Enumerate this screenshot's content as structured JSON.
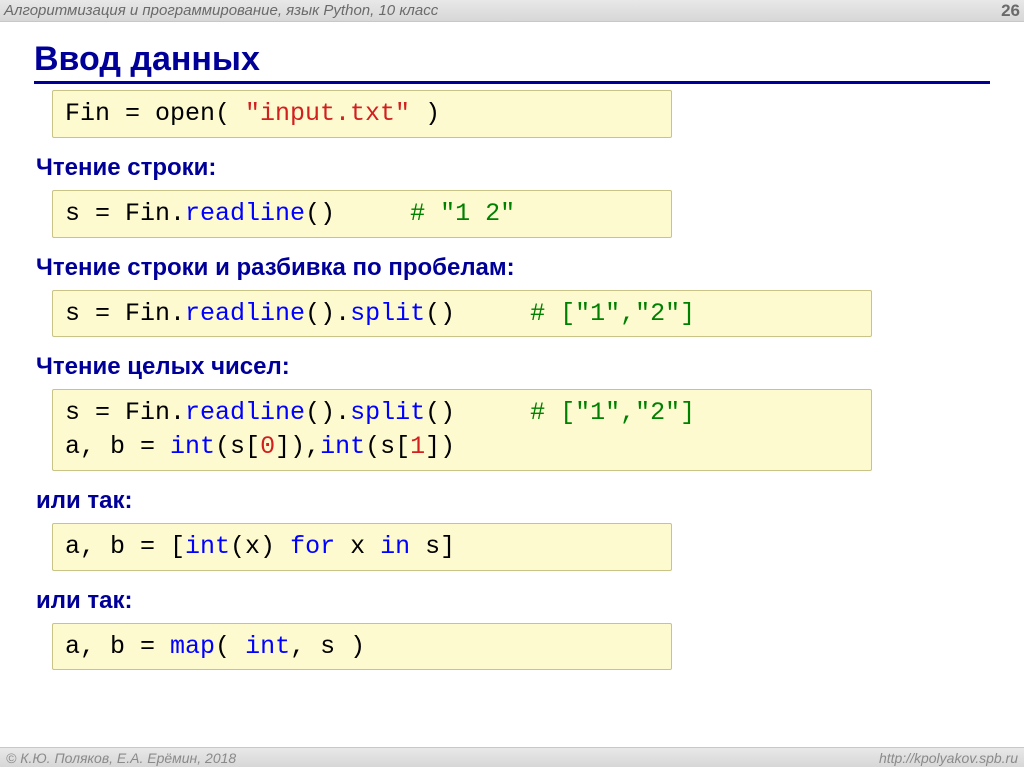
{
  "header": {
    "course": "Алгоритмизация и программирование, язык Python, 10 класс",
    "page": "26"
  },
  "title": "Ввод данных",
  "blocks": {
    "open_code": {
      "p1": "Fin = open( ",
      "s1": "\"input.txt\"",
      "p2": " )"
    },
    "label1": "Чтение строки:",
    "read1": {
      "p1": "s = Fin.",
      "m1": "readline",
      "p2": "()     ",
      "c1": "# \"1 2\""
    },
    "label2": "Чтение строки и разбивка по пробелам:",
    "read2": {
      "p1": "s = Fin.",
      "m1": "readline",
      "p2": "().",
      "m2": "split",
      "p3": "()     ",
      "c1": "# [\"1\",\"2\"]"
    },
    "label3": "Чтение целых чисел:",
    "read3": {
      "l1p1": "s = Fin.",
      "l1m1": "readline",
      "l1p2": "().",
      "l1m2": "split",
      "l1p3": "()     ",
      "l1c1": "# [\"1\",\"2\"]",
      "l2p1": "a, b = ",
      "l2m1": "int",
      "l2p2": "(s[",
      "l2n1": "0",
      "l2p3": "]),",
      "l2m2": "int",
      "l2p4": "(s[",
      "l2n2": "1",
      "l2p5": "])"
    },
    "label4": "или так:",
    "read4": {
      "p1": "a, b = [",
      "m1": "int",
      "p2": "(x) ",
      "k1": "for",
      "p3": " x ",
      "k2": "in",
      "p4": " s]"
    },
    "label5": "или так:",
    "read5": {
      "p1": "a, b = ",
      "m1": "map",
      "p2": "( ",
      "m2": "int",
      "p3": ", s )"
    }
  },
  "footer": {
    "copyright": "© К.Ю. Поляков, Е.А. Ерёмин, 2018",
    "url": "http://kpolyakov.spb.ru"
  }
}
